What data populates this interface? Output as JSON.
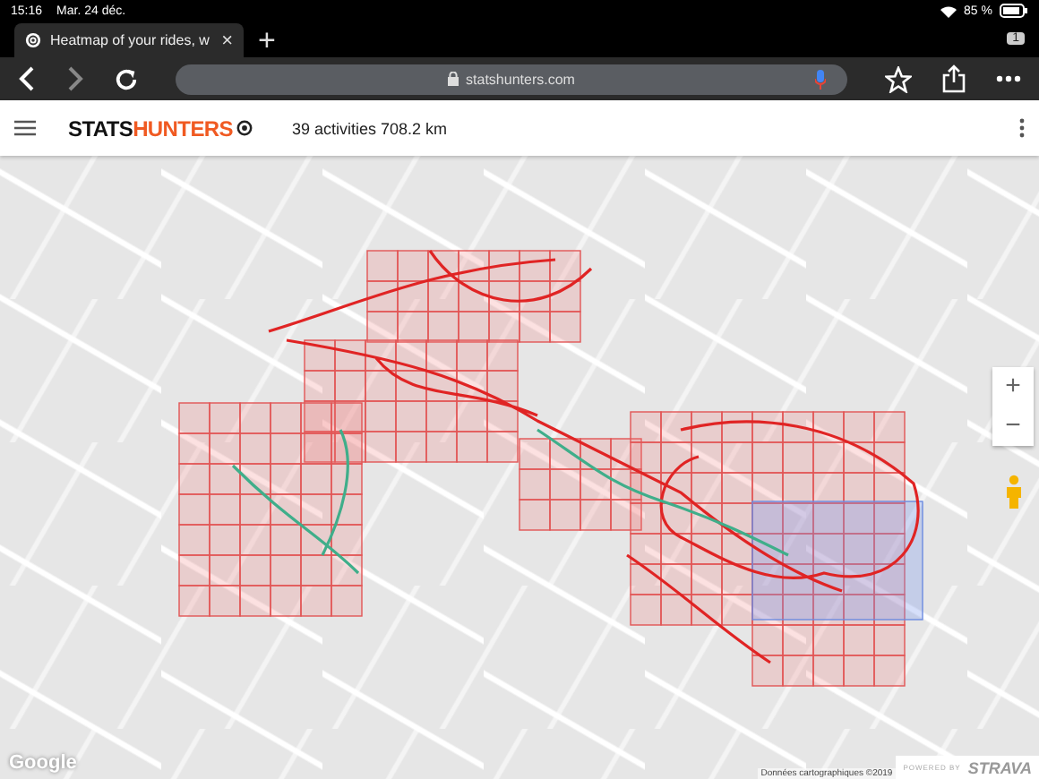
{
  "status_bar": {
    "time": "15:16",
    "date": "Mar. 24 déc.",
    "battery": "85 %"
  },
  "browser": {
    "tab": {
      "title": "Heatmap of your rides, w",
      "close": "×"
    },
    "new_tab": "+",
    "tab_count": "1",
    "url": "statshunters.com"
  },
  "header": {
    "logo": [
      "STATS",
      "HUNTERS"
    ],
    "summary": "39 activities 708.2 km"
  },
  "map": {
    "zoom_in": "+",
    "zoom_out": "−",
    "provider": "Google",
    "attribution": "Données cartographiques ©2019",
    "powered_by": "POWERED BY",
    "partner": "STRAVA"
  }
}
